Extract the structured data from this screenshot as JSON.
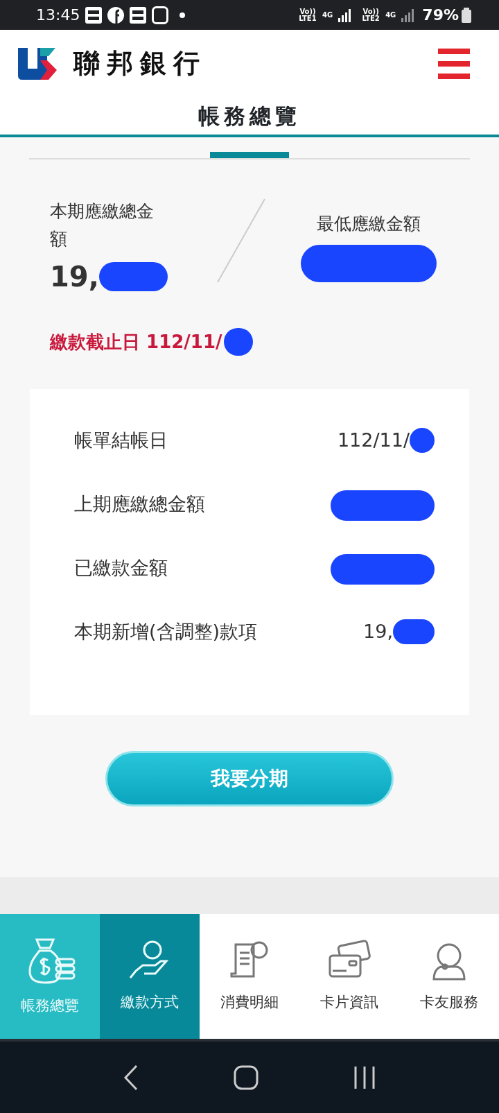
{
  "status_bar": {
    "time": "13:45",
    "network_1": "Vo)) LTE1",
    "net_type_1": "4G",
    "network_2": "Vo)) LTE2",
    "net_type_2": "4G",
    "battery": "79%"
  },
  "header": {
    "bank_name": "聯邦銀行"
  },
  "page_title": "帳務總覽",
  "summary": {
    "total_label": "本期應繳總金額",
    "total_value": "19,",
    "minimum_label": "最低應繳金額",
    "due_date": "繳款截止日 112/11/"
  },
  "details": [
    {
      "label": "帳單結帳日",
      "value": "112/11/"
    },
    {
      "label": "上期應繳總金額"
    },
    {
      "label": "已繳款金額"
    },
    {
      "label": "本期新增(含調整)款項",
      "value": "19,"
    }
  ],
  "installment_button": "我要分期",
  "tabs": [
    {
      "label": "帳務總覽",
      "kind": "bag",
      "selected": true,
      "pressed": false
    },
    {
      "label": "繳款方式",
      "kind": "hand",
      "selected": false,
      "pressed": true
    },
    {
      "label": "消費明細",
      "kind": "receipt",
      "selected": false,
      "pressed": false
    },
    {
      "label": "卡片資訊",
      "kind": "cards",
      "selected": false,
      "pressed": false
    },
    {
      "label": "卡友服務",
      "kind": "agent",
      "selected": false,
      "pressed": false
    }
  ]
}
